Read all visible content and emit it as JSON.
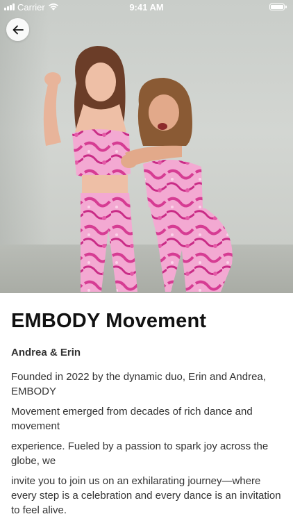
{
  "status_bar": {
    "carrier": "Carrier",
    "time": "9:41 AM"
  },
  "hero": {
    "image": "two-dancers-pink-tie-dye-outfits"
  },
  "icons": {
    "back": "arrow-left-icon",
    "wifi": "wifi-icon",
    "battery": "battery-icon",
    "signal": "signal-icon"
  },
  "colors": {
    "accent_pink": "#e0489f",
    "text": "#333333",
    "title": "#111111"
  },
  "content": {
    "title": "EMBODY Movement",
    "subtitle": "Andrea & Erin",
    "paragraphs": [
      "Founded in 2022 by the dynamic duo, Erin and Andrea, EMBODY",
      "Movement emerged from decades of rich dance and movement",
      "experience. Fueled by a passion to spark joy across the globe, we",
      "invite you to join us on an exhilarating journey—where every step is a celebration and every dance is an invitation to feel alive."
    ]
  }
}
